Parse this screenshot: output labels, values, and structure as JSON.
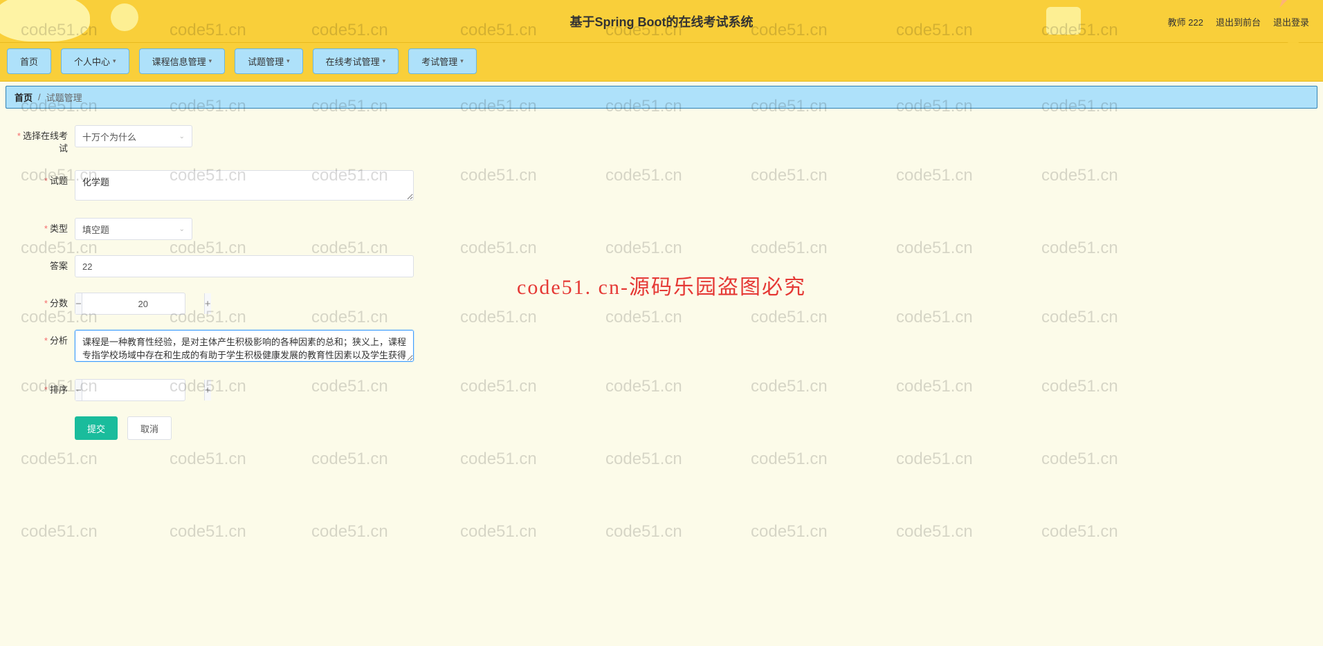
{
  "header": {
    "title": "基于Spring Boot的在线考试系统",
    "user": "教师 222",
    "back_front": "退出到前台",
    "logout": "退出登录"
  },
  "nav": {
    "home": "首页",
    "personal": "个人中心",
    "course": "课程信息管理",
    "question": "试题管理",
    "online_exam": "在线考试管理",
    "exam": "考试管理"
  },
  "breadcrumb": {
    "home": "首页",
    "current": "试题管理"
  },
  "form": {
    "labels": {
      "select_exam": "选择在线考试",
      "question": "试题",
      "type": "类型",
      "answer": "答案",
      "score": "分数",
      "analysis": "分析",
      "order": "排序"
    },
    "values": {
      "select_exam": "十万个为什么",
      "question": "化学题",
      "type": "填空题",
      "answer": "22",
      "score": "20",
      "analysis": "课程是一种教育性经验，是对主体产生积极影响的各种因素的总和；狭义上，课程专指学校场域中存在和生成的有助于学生积极健康发展的教育性因素以及学生获得的教育性经验",
      "order": ""
    },
    "buttons": {
      "submit": "提交",
      "cancel": "取消"
    }
  },
  "watermark": {
    "text": "code51.cn",
    "center": "code51. cn-源码乐园盗图必究"
  }
}
